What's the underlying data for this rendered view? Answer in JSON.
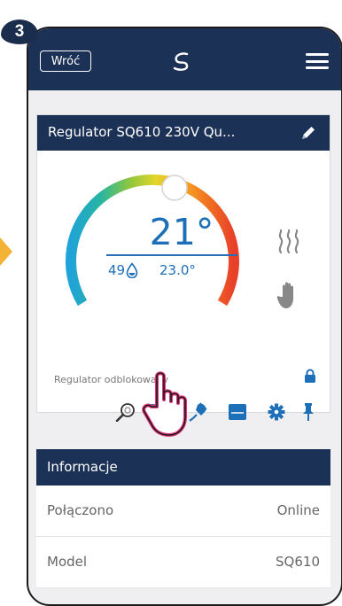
{
  "step_badge": "3",
  "header": {
    "back_label": "Wróć"
  },
  "device_card": {
    "title": "Regulator SQ610 230V Qu...",
    "current_temp": "21°",
    "humidity": "49",
    "set_temp": "23.0°",
    "lock_status": "Regulator odblokowany"
  },
  "info_section": {
    "title": "Informacje",
    "rows": [
      {
        "label": "Połączono",
        "value": "Online"
      },
      {
        "label": "Model",
        "value": "SQ610"
      }
    ]
  },
  "colors": {
    "navy": "#1c3156",
    "accent_blue": "#1d6fb8",
    "arrow": "#f5b335",
    "cursor_outline": "#e0357a"
  },
  "icons": [
    "back-button",
    "salus-logo-icon",
    "menu-icon",
    "pencil-icon",
    "heat-waves-icon",
    "hand-icon",
    "lock-icon",
    "search-icon",
    "window-icon",
    "plug-icon",
    "floor-heating-icon",
    "gear-icon",
    "pin-icon",
    "hand-pointer-icon"
  ]
}
